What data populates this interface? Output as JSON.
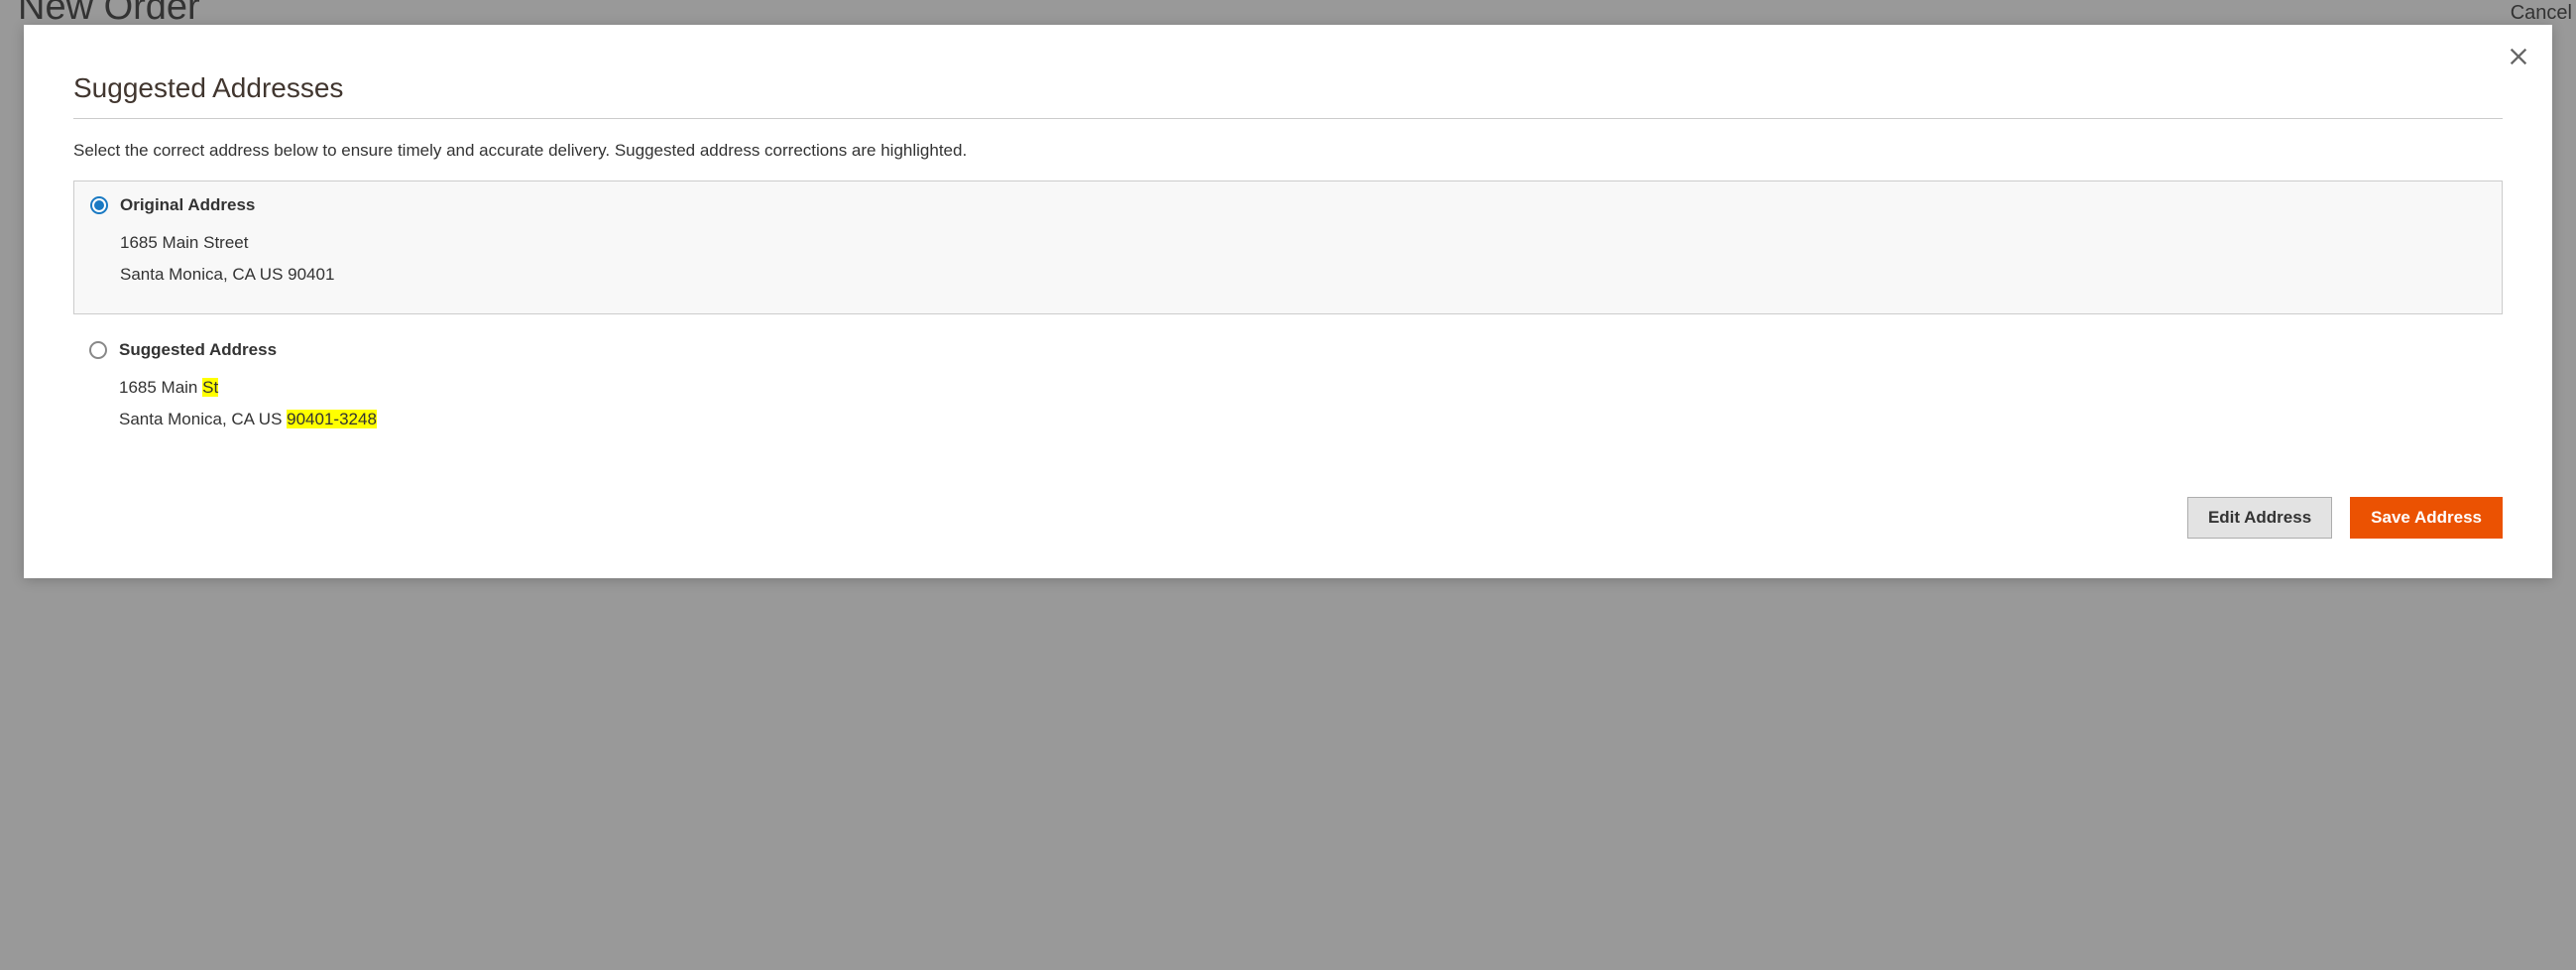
{
  "background": {
    "page_title": "New Order",
    "cancel_label": "Cancel"
  },
  "modal": {
    "title": "Suggested Addresses",
    "instruction": "Select the correct address below to ensure timely and accurate delivery. Suggested address corrections are highlighted.",
    "options": {
      "original": {
        "label": "Original Address",
        "line1": "1685 Main Street",
        "line2": "Santa Monica, CA US 90401",
        "selected": true
      },
      "suggested": {
        "label": "Suggested Address",
        "line1_prefix": "1685 Main ",
        "line1_highlight": "St",
        "line2_prefix": "Santa Monica, CA US ",
        "line2_highlight": "90401-3248",
        "selected": false
      }
    },
    "buttons": {
      "edit": "Edit Address",
      "save": "Save Address"
    }
  }
}
